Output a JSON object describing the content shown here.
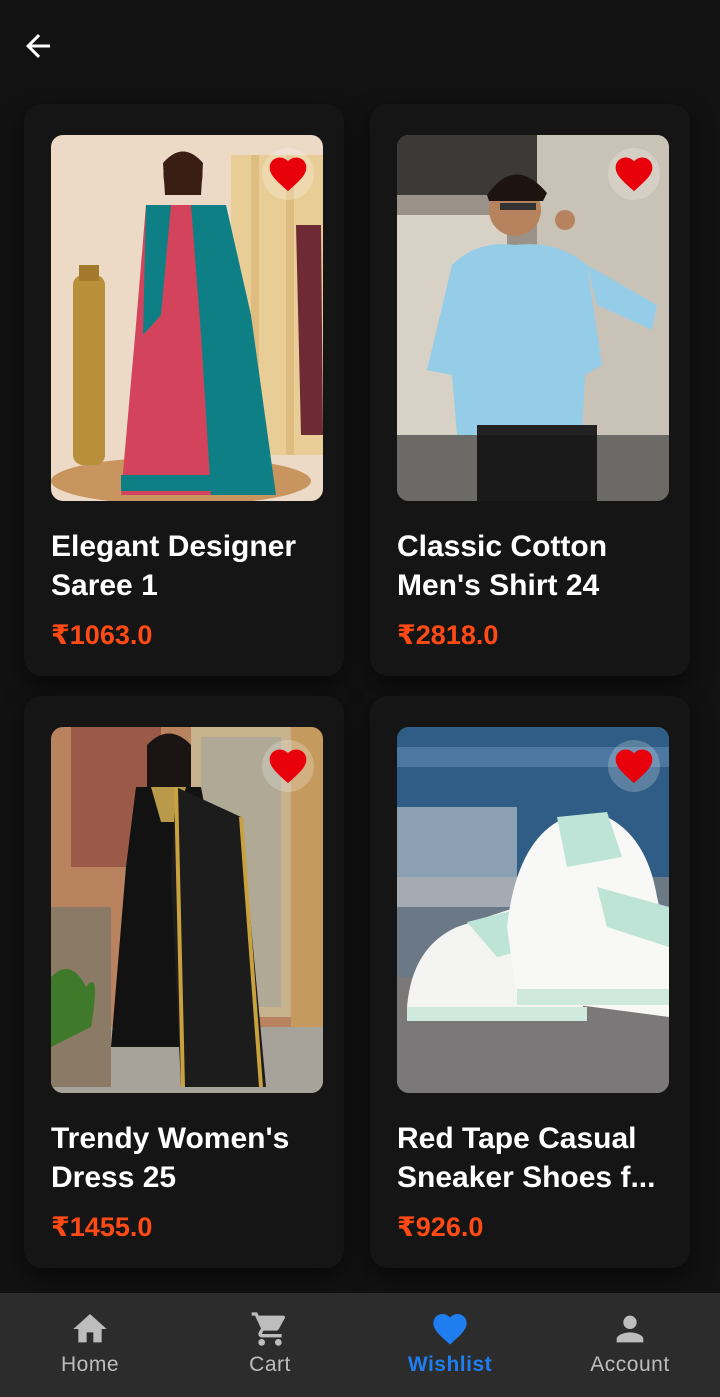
{
  "header": {
    "back_icon": "arrow-back-icon"
  },
  "products": [
    {
      "title": "Elegant Designer Saree 1",
      "price": "₹1063.0",
      "image": "woman in teal and pink silk saree",
      "wishlisted": true
    },
    {
      "title": "Classic Cotton Men's Shirt 24",
      "price": "₹2818.0",
      "image": "man in light blue shirt with glasses",
      "wishlisted": true
    },
    {
      "title": "Trendy Women's Dress 25",
      "price": "₹1455.0",
      "image": "woman in black dress with gold dupatta",
      "wishlisted": true
    },
    {
      "title": "Red Tape Casual Sneaker Shoes f...",
      "price": "₹926.0",
      "image": "white and mint sneakers",
      "wishlisted": true
    }
  ],
  "bottom_nav": {
    "items": [
      {
        "label": "Home",
        "icon": "home-icon",
        "active": false
      },
      {
        "label": "Cart",
        "icon": "cart-icon",
        "active": false
      },
      {
        "label": "Wishlist",
        "icon": "heart-icon",
        "active": true
      },
      {
        "label": "Account",
        "icon": "account-icon",
        "active": false
      }
    ]
  },
  "colors": {
    "background": "#121212",
    "card": "#151515",
    "price": "#ff4a16",
    "heart": "#e8000b",
    "nav_background": "#2c2c2c",
    "nav_active": "#1e7ef0",
    "nav_inactive": "#bdbdbd"
  }
}
